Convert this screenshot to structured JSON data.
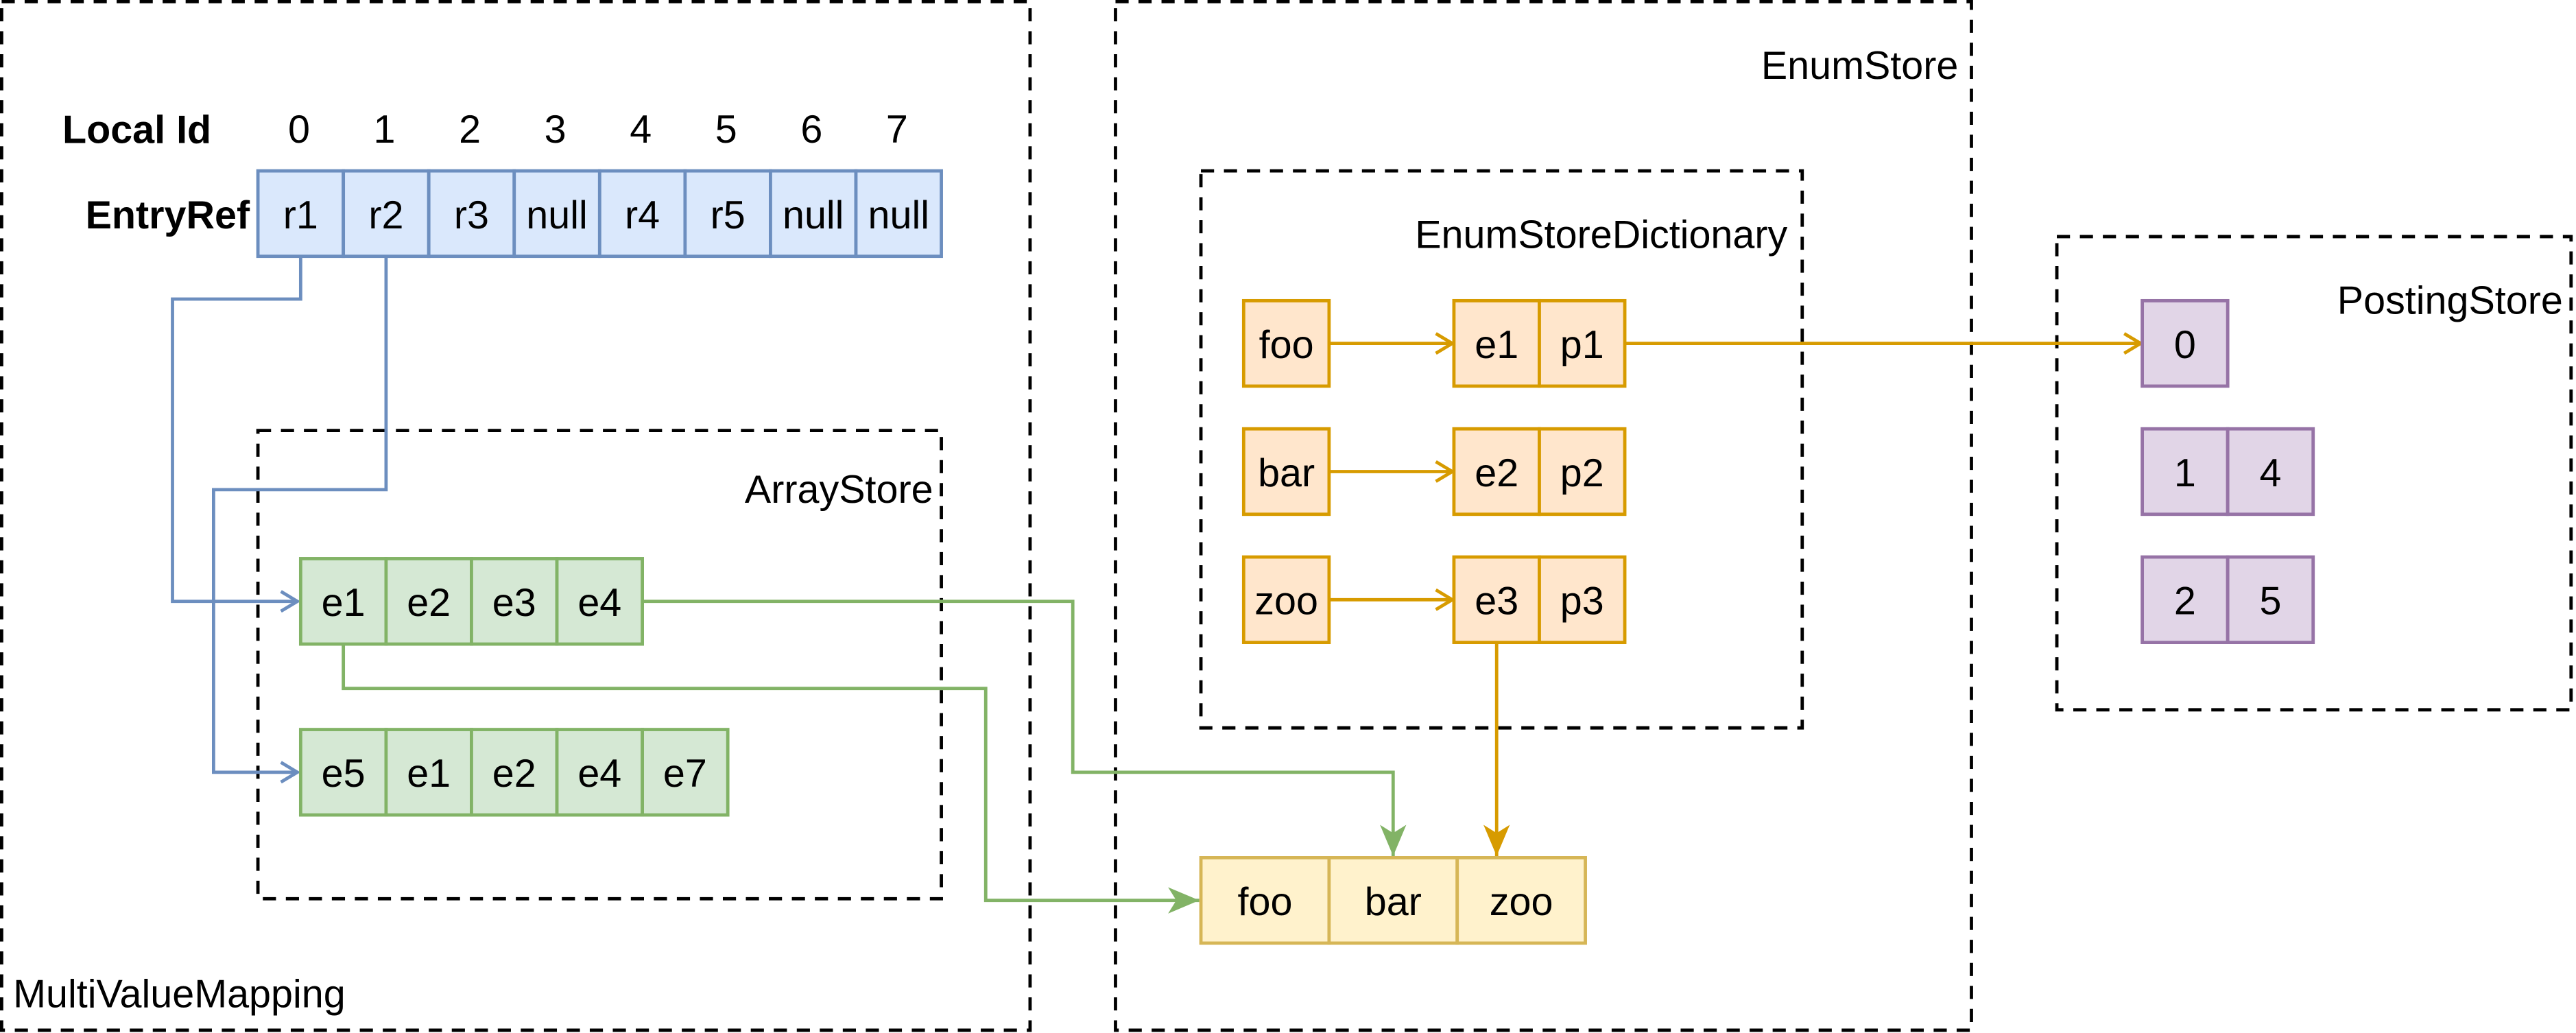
{
  "colors": {
    "blue": {
      "fill": "#dae8fc",
      "stroke": "#6c8ebf"
    },
    "green": {
      "fill": "#d5e8d4",
      "stroke": "#82b366"
    },
    "orange": {
      "fill": "#ffe6cc",
      "stroke": "#d79b00"
    },
    "purple": {
      "fill": "#e1d5e7",
      "stroke": "#9673a6"
    },
    "yellow": {
      "fill": "#fff2cc",
      "stroke": "#d6b656"
    }
  },
  "multi_value_mapping": {
    "title": "MultiValueMapping",
    "local_id_label": "Local Id",
    "local_ids": [
      "0",
      "1",
      "2",
      "3",
      "4",
      "5",
      "6",
      "7"
    ],
    "entry_ref_label": "EntryRef",
    "entry_refs": [
      "r1",
      "r2",
      "r3",
      "null",
      "r4",
      "r5",
      "null",
      "null"
    ],
    "array_store": {
      "title": "ArrayStore",
      "arrays": [
        [
          "e1",
          "e2",
          "e3",
          "e4"
        ],
        [
          "e5",
          "e1",
          "e2",
          "e4",
          "e7"
        ]
      ]
    }
  },
  "enum_store": {
    "title": "EnumStore",
    "dictionary": {
      "title": "EnumStoreDictionary",
      "entries": [
        {
          "key": "foo",
          "enum": "e1",
          "posting": "p1"
        },
        {
          "key": "bar",
          "enum": "e2",
          "posting": "p2"
        },
        {
          "key": "zoo",
          "enum": "e3",
          "posting": "p3"
        }
      ]
    },
    "values": [
      "foo",
      "bar",
      "zoo"
    ]
  },
  "posting_store": {
    "title": "PostingStore",
    "lists": [
      [
        "0"
      ],
      [
        "1",
        "4"
      ],
      [
        "2",
        "5"
      ]
    ]
  }
}
